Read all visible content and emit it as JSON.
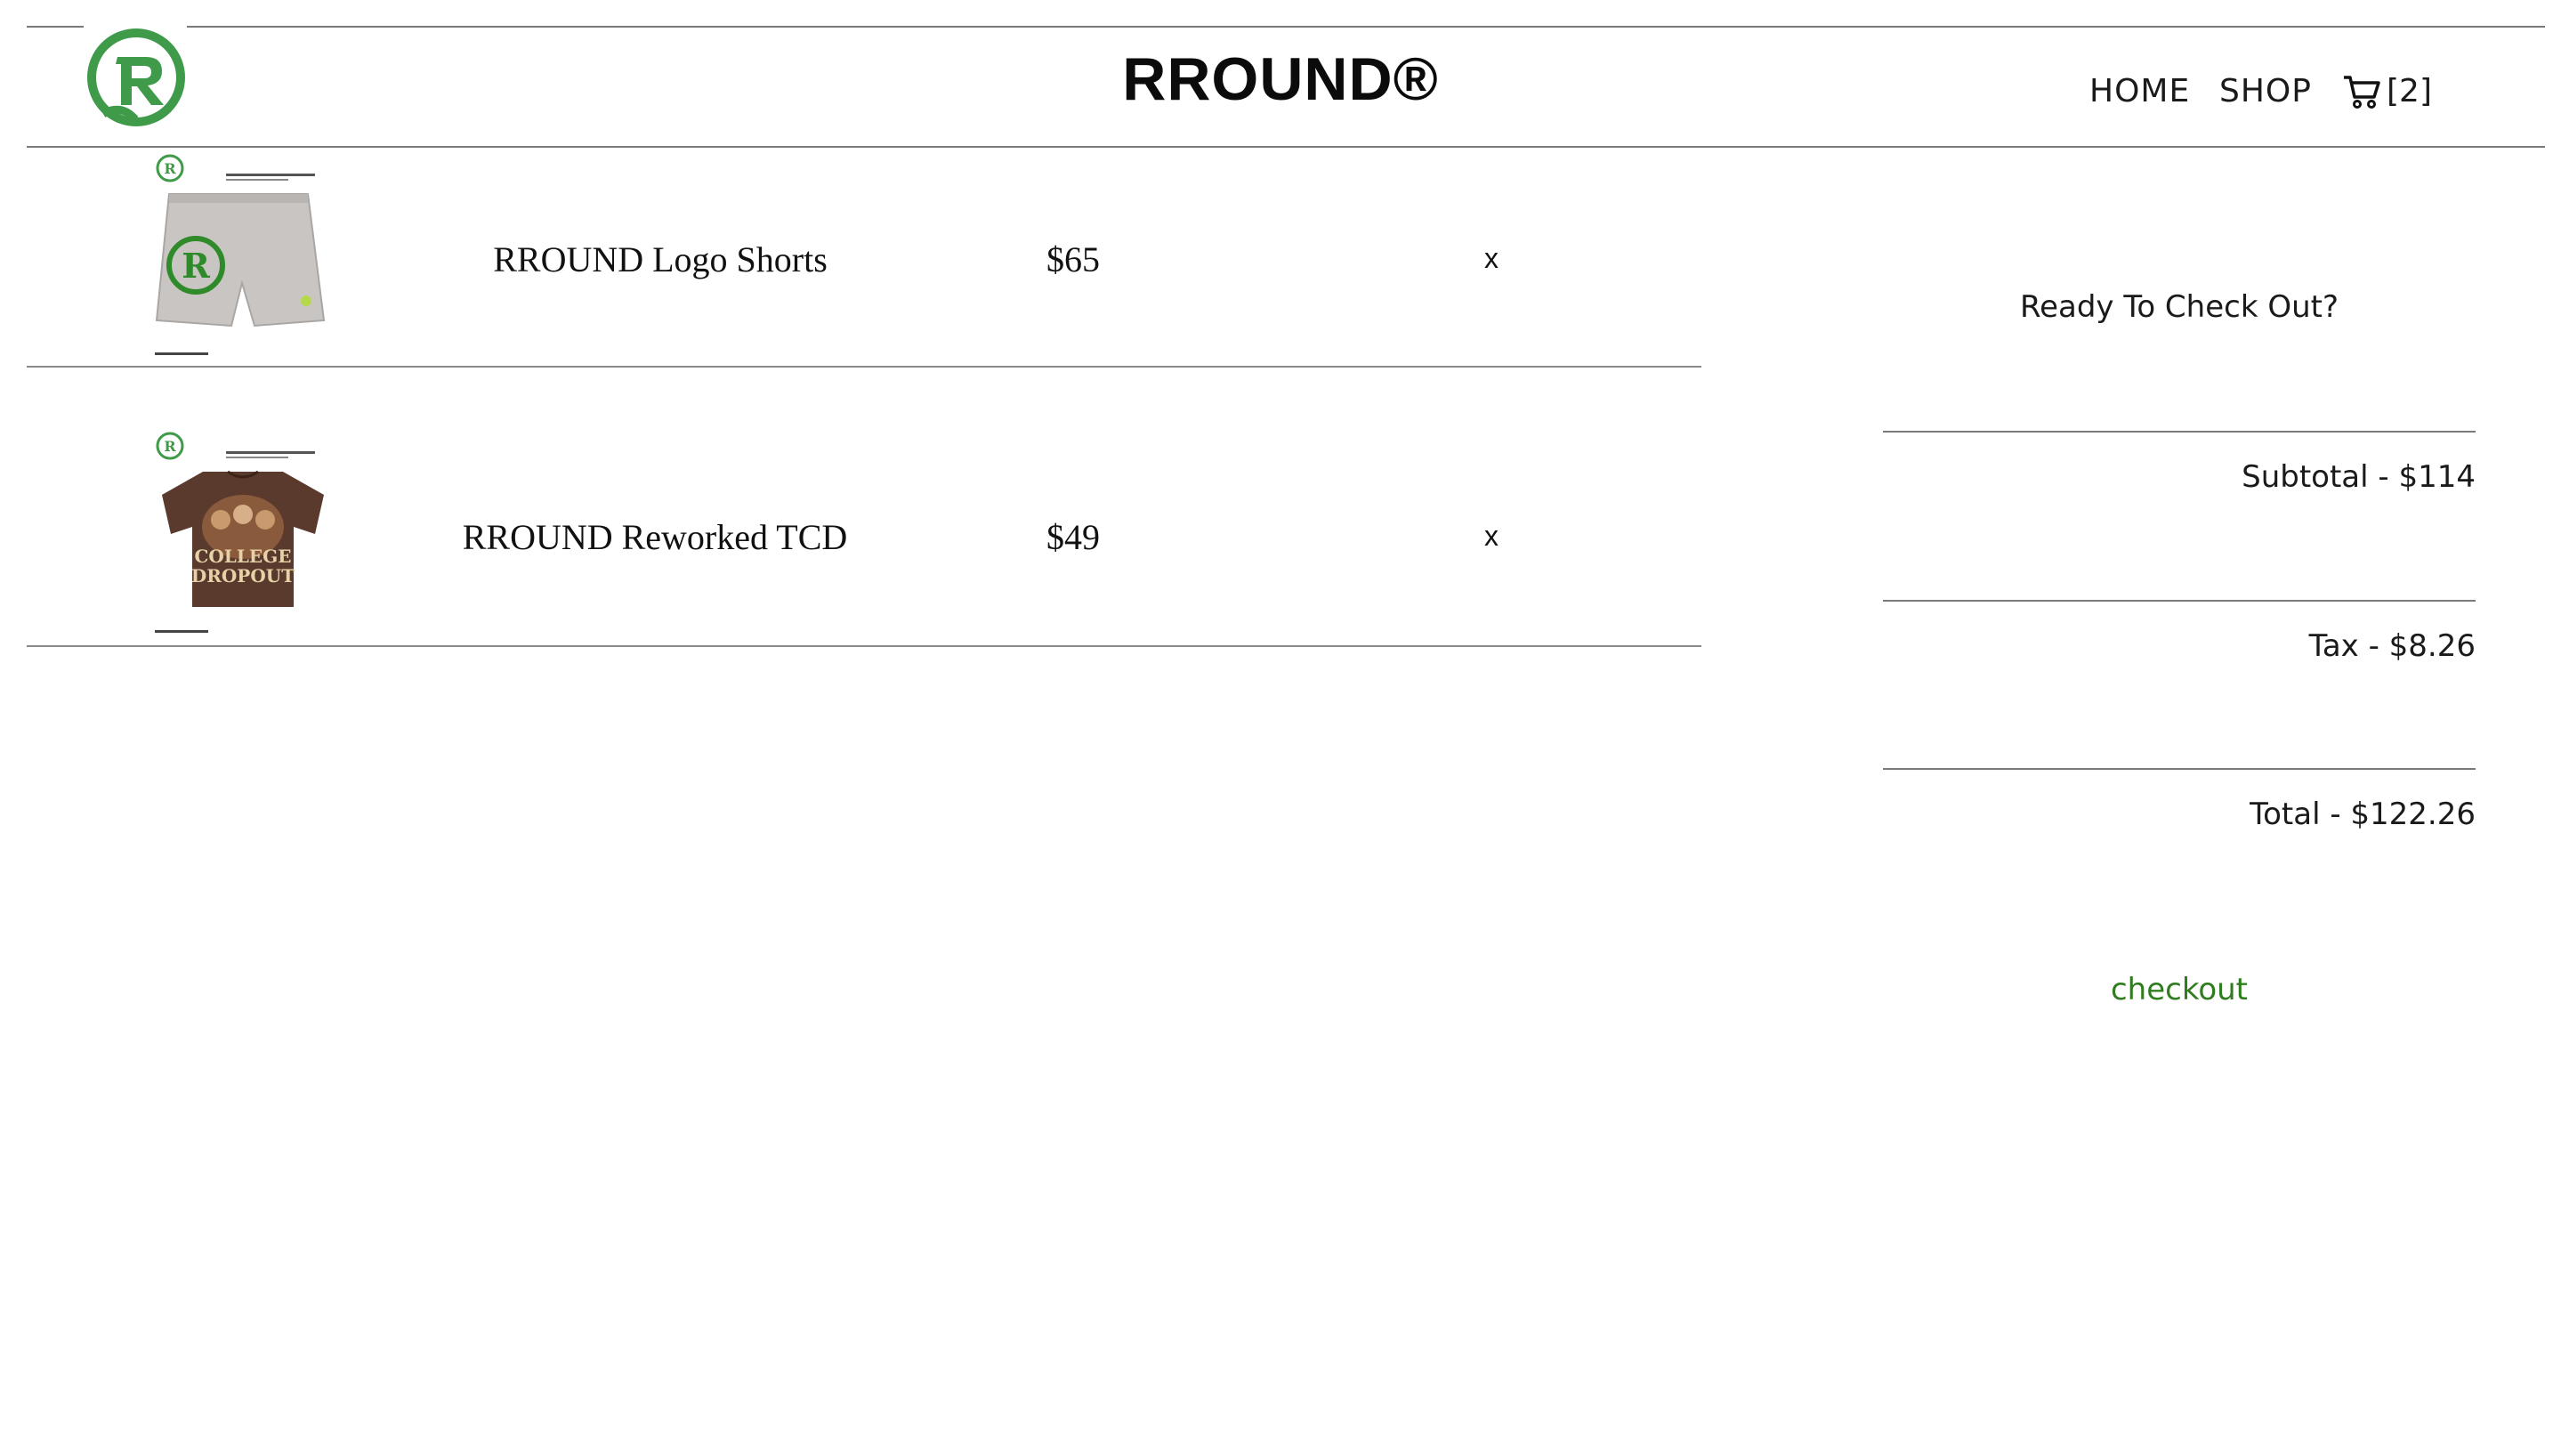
{
  "header": {
    "brand": "RROUND®",
    "nav": {
      "home": "HOME",
      "shop": "SHOP"
    },
    "cart_count": "[2]"
  },
  "cart": {
    "items": [
      {
        "name": "RROUND Logo Shorts",
        "price": "$65",
        "remove": "x",
        "thumbnail": "gray-shorts-with-green-logo"
      },
      {
        "name": "RROUND Reworked TCD",
        "price": "$49",
        "remove": "x",
        "thumbnail": "brown-tshirt-college-dropout"
      }
    ]
  },
  "thumbnail_text": {
    "shirt_line1": "COLLEGE",
    "shirt_line2": "DROPOUT"
  },
  "summary": {
    "heading": "Ready To Check Out?",
    "subtotal": "Subtotal - $114",
    "tax": "Tax - $8.26",
    "total": "Total - $122.26",
    "checkout": "checkout"
  },
  "colors": {
    "brand_green": "#3f9a4a",
    "checkout_green": "#2f7d1f",
    "divider": "#7a7a7a",
    "shirt_brown": "#5a3a2c",
    "shorts_gray": "#c8c5c3"
  }
}
